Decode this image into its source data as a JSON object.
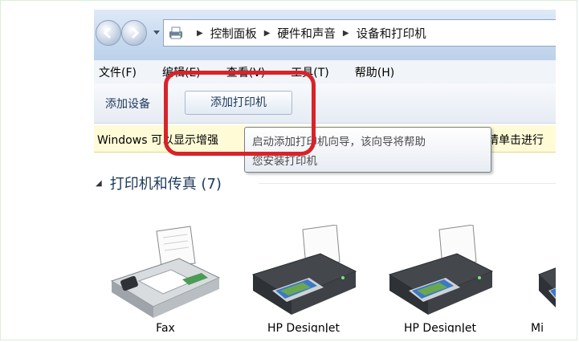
{
  "address_bar": {
    "breadcrumbs": [
      "控制面板",
      "硬件和声音",
      "设备和打印机"
    ]
  },
  "menu": [
    "文件(F)",
    "编辑(E)",
    "查看(V)",
    "工具(T)",
    "帮助(H)"
  ],
  "command_bar": {
    "add_device": "添加设备",
    "add_printer": "添加打印机"
  },
  "info_bar": {
    "left_text": "Windows 可以显示增强",
    "right_text": "请单击进行"
  },
  "tooltip": {
    "line1": "启动添加打印机向导，该向导将帮助",
    "line2": "您安装打印机"
  },
  "group": {
    "title": "打印机和传真 (7)"
  },
  "devices": [
    {
      "label": "Fax",
      "icon": "fax-icon"
    },
    {
      "label": "HP DesignJet",
      "icon": "printer-icon"
    },
    {
      "label": "HP DesignJet",
      "icon": "printer-icon"
    },
    {
      "label": "Mi",
      "icon": "printer-icon"
    }
  ],
  "colors": {
    "highlight": "#d8232a",
    "info_bar_bg": "#fffbd7",
    "link_text": "#1e395b"
  }
}
